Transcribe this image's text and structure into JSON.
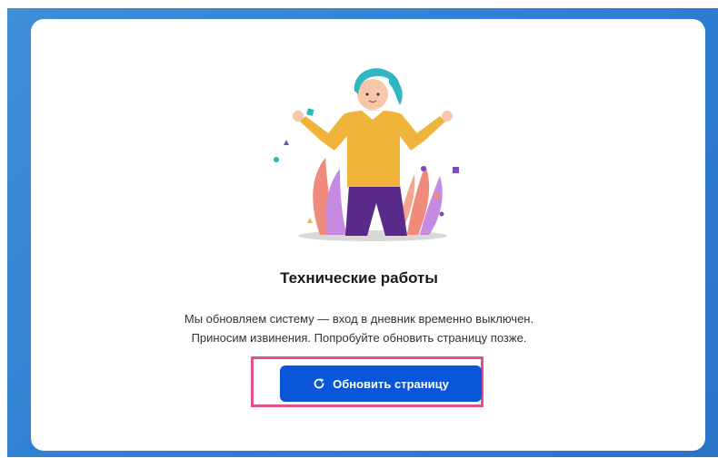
{
  "maintenance": {
    "title": "Технические работы",
    "line1": "Мы обновляем систему — вход в дневник временно выключен.",
    "line2": "Приносим извинения. Попробуйте обновить страницу позже.",
    "refresh_button": "Обновить страницу",
    "refresh_icon": "refresh-icon"
  },
  "colors": {
    "background": "#2f7fd3",
    "card": "#ffffff",
    "button": "#0a56d9",
    "highlight": "#e0508a"
  }
}
